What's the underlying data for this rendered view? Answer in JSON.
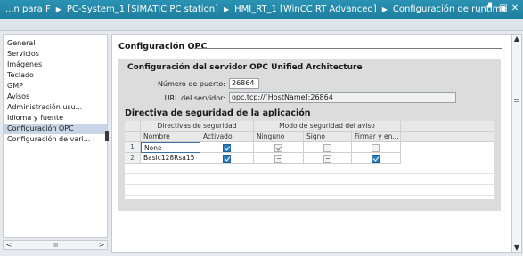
{
  "window": {
    "breadcrumbs": [
      "...n para F",
      "PC-System_1 [SIMATIC PC station]",
      "HMI_RT_1 [WinCC RT Advanced]",
      "Configuración de runtime"
    ],
    "separator": "▶",
    "controls": {
      "minimize": "_",
      "restore": "▘",
      "maximize": "▣",
      "close": "✕"
    }
  },
  "sidebar": {
    "items": [
      {
        "label": "General"
      },
      {
        "label": "Servicios"
      },
      {
        "label": "Imágenes"
      },
      {
        "label": "Teclado"
      },
      {
        "label": "GMP"
      },
      {
        "label": "Avisos"
      },
      {
        "label": "Administración usu..."
      },
      {
        "label": "Idioma y fuente"
      },
      {
        "label": "Configuración OPC"
      },
      {
        "label": "Configuración de vari..."
      }
    ],
    "selected_index": 8,
    "scroll_left": "<",
    "scroll_thumb": "III",
    "scroll_right": ">"
  },
  "main": {
    "section_title": "Configuración OPC",
    "server_title": "Configuración del servidor OPC Unified Architecture",
    "port_label": "Número de puerto:",
    "port_value": "26864",
    "url_label": "URL del servidor:",
    "url_value": "opc.tcp://[HostName]:26864",
    "policy_title": "Directiva de seguridad de la aplicación",
    "table": {
      "group_headers": {
        "policies": "Directivas de seguridad",
        "modes": "Modo de seguridad del aviso"
      },
      "columns": [
        "Nombre",
        "Activado",
        "Ninguno",
        "Signo",
        "Firmar y en..."
      ],
      "rows": [
        {
          "index": "1",
          "name": "None",
          "enabled": true,
          "none": true,
          "sign": false,
          "sign_encrypt": false
        },
        {
          "index": "2",
          "name": "Basic128Rsa15",
          "enabled": true,
          "none": false,
          "sign": false,
          "sign_encrypt": true
        }
      ]
    }
  },
  "scrollbar": {
    "up": "▲",
    "down": "▼"
  },
  "colors": {
    "titlebar": "#2a92b3",
    "selection": "#c7d5e6",
    "checkbox_on": "#2a7fc0"
  }
}
